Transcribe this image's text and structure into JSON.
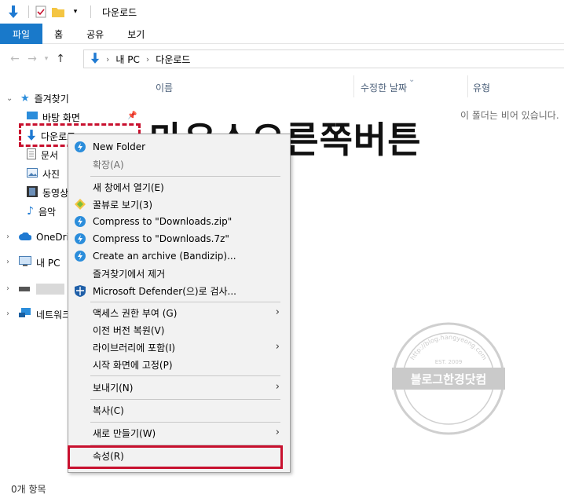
{
  "window": {
    "title": "다운로드"
  },
  "ribbon": {
    "tabs": [
      "파일",
      "홈",
      "공유",
      "보기"
    ]
  },
  "address": {
    "crumbs": [
      "내 PC",
      "다운로드"
    ]
  },
  "navpane": {
    "quick_access": "즐겨찾기",
    "items": [
      "바탕 화면",
      "다운로드",
      "문서",
      "사진",
      "동영상",
      "음악"
    ],
    "onedrive": "OneDrive",
    "this_pc": "내 PC",
    "network": "네트워크"
  },
  "columns": {
    "name": "이름",
    "modified": "수정한 날짜",
    "type": "유형"
  },
  "empty_message": "이 폴더는 비어 있습니다.",
  "status": {
    "items": "0개 항목"
  },
  "overlay": {
    "caption": "마우스오른쪽버튼"
  },
  "context_menu": {
    "items": [
      {
        "label": "New Folder",
        "disabled": false
      },
      {
        "label": "확장(A)",
        "disabled": true
      },
      {
        "label": "새 창에서 열기(E)"
      },
      {
        "label": "꿀뷰로 보기(3)"
      },
      {
        "label": "Compress to \"Downloads.zip\""
      },
      {
        "label": "Compress to \"Downloads.7z\""
      },
      {
        "label": "Create an archive (Bandizip)..."
      },
      {
        "label": "즐겨찾기에서 제거"
      },
      {
        "label": "Microsoft Defender(으)로 검사..."
      },
      {
        "label": "액세스 권한 부여 (G)"
      },
      {
        "label": "이전 버전 복원(V)"
      },
      {
        "label": "라이브러리에 포함(I)"
      },
      {
        "label": "시작 화면에 고정(P)"
      },
      {
        "label": "보내기(N)"
      },
      {
        "label": "복사(C)"
      },
      {
        "label": "새로 만들기(W)"
      },
      {
        "label": "속성(R)"
      }
    ]
  },
  "watermark": {
    "top": "http://blog.hangyeong.com",
    "mid": "블로그한경닷컴",
    "est": "EST. 2009"
  },
  "colors": {
    "accent": "#1979ca",
    "highlight_red": "#c8102e"
  }
}
